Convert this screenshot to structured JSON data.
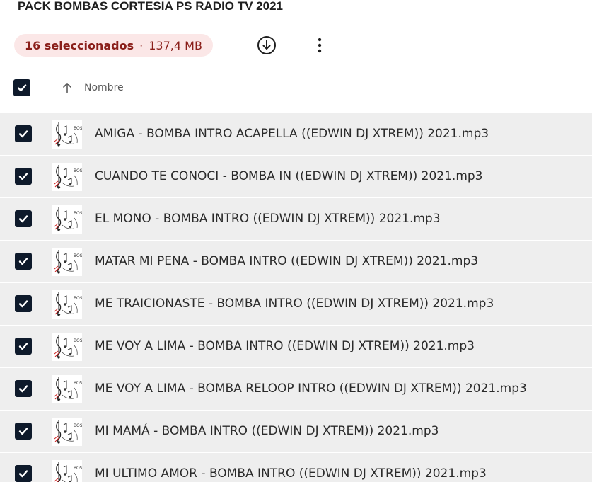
{
  "folder": {
    "title": "PACK BOMBAS CORTESIA PS RADIO TV 2021"
  },
  "toolbar": {
    "selected_label": "16 seleccionados",
    "separator": "·",
    "total_size": "137,4 MB",
    "download_icon": "download-circle-icon",
    "more_icon": "more-vert-icon"
  },
  "list_header": {
    "name_label": "Nombre",
    "sort_icon": "arrow-up-icon",
    "sort_direction": "ascending",
    "all_selected": true
  },
  "files": [
    {
      "name": "AMIGA - BOMBA INTRO ACAPELLA ((EDWIN DJ XTREM)) 2021.mp3",
      "selected": true
    },
    {
      "name": "CUANDO TE CONOCI - BOMBA IN ((EDWIN DJ XTREM)) 2021.mp3",
      "selected": true
    },
    {
      "name": "EL MONO - BOMBA INTRO ((EDWIN DJ XTREM)) 2021.mp3",
      "selected": true
    },
    {
      "name": "MATAR MI PENA - BOMBA INTRO ((EDWIN DJ XTREM)) 2021.mp3",
      "selected": true
    },
    {
      "name": "ME TRAICIONASTE - BOMBA INTRO ((EDWIN DJ XTREM)) 2021.mp3",
      "selected": true
    },
    {
      "name": "ME VOY A LIMA - BOMBA INTRO ((EDWIN DJ XTREM)) 2021.mp3",
      "selected": true
    },
    {
      "name": "ME VOY A LIMA - BOMBA RELOOP INTRO ((EDWIN DJ XTREM)) 2021.mp3",
      "selected": true
    },
    {
      "name": "MI MAMÁ - BOMBA INTRO ((EDWIN DJ XTREM)) 2021.mp3",
      "selected": true
    },
    {
      "name": "MI ULTIMO AMOR - BOMBA INTRO ((EDWIN DJ XTREM)) 2021.mp3",
      "selected": true
    }
  ],
  "colors": {
    "selection_pill_bg": "#fbe7e7",
    "selection_text": "#8a1f1a",
    "checkbox_fill": "#0e1a2b",
    "row_bg": "#eeeeee"
  }
}
